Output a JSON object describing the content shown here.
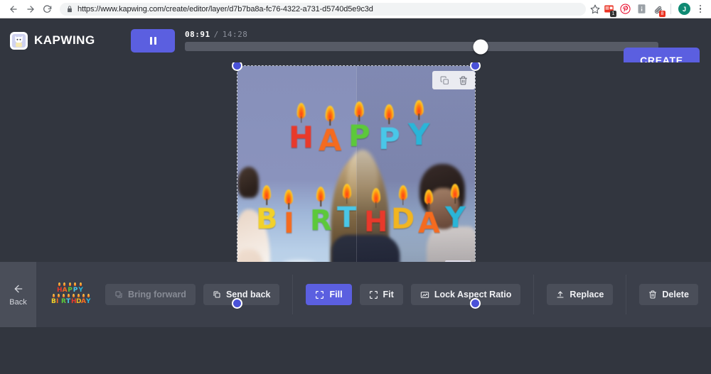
{
  "browser": {
    "back_icon": "back-arrow-icon",
    "forward_icon": "forward-arrow-icon",
    "reload_icon": "reload-icon",
    "lock_icon": "lock-icon",
    "url_scheme": "https://",
    "url_host": "www.kapwing.com",
    "url_path": "/create/editor/layer/d7b7ba8a-fc76-4322-a731-d5740d5e9c3d",
    "url_full": "https://www.kapwing.com/create/editor/layer/d7b7ba8a-fc76-4322-a731-d5740d5e9c3d",
    "bookmark_icon": "star-icon",
    "extensions": [
      {
        "name": "news-extension-icon",
        "badge": "1",
        "badge_color": "#333333",
        "color": "#ea3323"
      },
      {
        "name": "pinterest-extension-icon",
        "badge": "",
        "badge_color": "",
        "color": "#e60023"
      },
      {
        "name": "info-extension-icon",
        "badge": "",
        "badge_color": "",
        "color": "#9aa0a6"
      },
      {
        "name": "clipboard-extension-icon",
        "badge": "8",
        "badge_color": "#ea3323",
        "color": "#5f6368"
      }
    ],
    "profile_initial": "J",
    "profile_color": "#0f8a73",
    "menu_icon": "kebab-menu-icon"
  },
  "header": {
    "brand_name": "KAPWING",
    "brand_logo_icon": "kapwing-cat-logo-icon",
    "play_button": {
      "name": "pause-button",
      "icon": "pause-icon"
    },
    "time_current": "08:91",
    "time_separator": "/",
    "time_duration": "14:28",
    "scrubber_position_percent": 62.4,
    "create_label": "CREATE",
    "accent_color": "#5b5fe0"
  },
  "canvas": {
    "layer_selected": true,
    "float_toolbar": [
      {
        "name": "duplicate-layer-button",
        "icon": "copy-icon"
      },
      {
        "name": "delete-layer-button",
        "icon": "trash-icon"
      }
    ],
    "handles": [
      "top-left",
      "top-right",
      "bottom-left",
      "bottom-right"
    ],
    "handle_color": "#4a52d8",
    "watermark_icon": "kapwing-watermark-icon",
    "candles_line1": [
      {
        "char": "H",
        "color": "#e8392b"
      },
      {
        "char": "A",
        "color": "#f56b1f"
      },
      {
        "char": "P",
        "color": "#5cc93a"
      },
      {
        "char": "P",
        "color": "#49c7e8"
      },
      {
        "char": "Y",
        "color": "#2ab5d8"
      }
    ],
    "candles_line2": [
      {
        "char": "B",
        "color": "#f2d12a"
      },
      {
        "char": "I",
        "color": "#f56b1f"
      },
      {
        "char": "R",
        "color": "#5cc93a"
      },
      {
        "char": "T",
        "color": "#49c7e8"
      },
      {
        "char": "H",
        "color": "#e8392b"
      },
      {
        "char": "D",
        "color": "#f2b51f"
      },
      {
        "char": "A",
        "color": "#f56b1f"
      },
      {
        "char": "Y",
        "color": "#2ab5d8"
      }
    ]
  },
  "bottom_toolbar": {
    "back": {
      "label": "Back",
      "icon": "back-arrow-icon"
    },
    "thumbnail": {
      "name": "layer-thumbnail",
      "line1": "HAPPY",
      "line2": "BIRTHDAY"
    },
    "buttons": [
      {
        "name": "bring-forward-button",
        "label": "Bring forward",
        "icon": "bring-forward-icon",
        "state": "disabled"
      },
      {
        "name": "send-back-button",
        "label": "Send back",
        "icon": "send-back-icon",
        "state": "enabled"
      },
      {
        "name": "fill-button",
        "label": "Fill",
        "icon": "fill-icon",
        "state": "active"
      },
      {
        "name": "fit-button",
        "label": "Fit",
        "icon": "fit-icon",
        "state": "enabled"
      },
      {
        "name": "lock-aspect-ratio-button",
        "label": "Lock Aspect Ratio",
        "icon": "aspect-ratio-icon",
        "state": "enabled"
      },
      {
        "name": "replace-button",
        "label": "Replace",
        "icon": "upload-icon",
        "state": "enabled"
      },
      {
        "name": "delete-button",
        "label": "Delete",
        "icon": "trash-icon",
        "state": "enabled"
      }
    ]
  }
}
